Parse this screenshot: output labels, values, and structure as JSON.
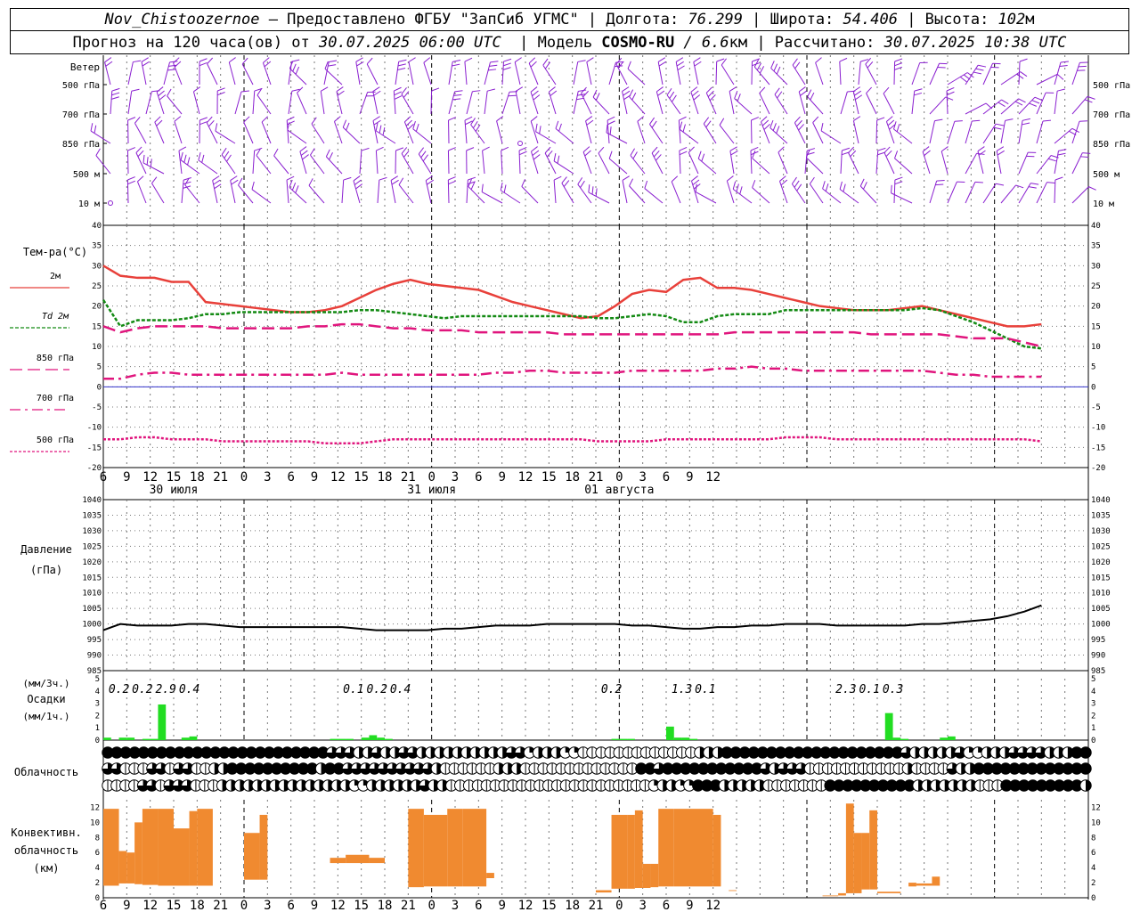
{
  "header": {
    "station": "Nov_Chistoozernoe",
    "provided": " – Предоставлено ФГБУ \"ЗапСиб УГМС\" | Долгота: ",
    "lon": "76.299",
    "lat_label": " | Широта: ",
    "lat": "54.406",
    "alt_label": " | Высота: ",
    "alt": "102",
    "alt_unit": "м",
    "forecast_label": "Прогноз на 120 часа(ов) от ",
    "run_time": "30.07.2025 06:00 UTC",
    "model_label": "  | Модель ",
    "model": "COSMO-RU",
    "model_res": " / 6.6",
    "model_res_unit": "км",
    "calc_label": " | Рассчитано: ",
    "calc_time": "30.07.2025 10:38 UTC"
  },
  "colors": {
    "t2m": "#e8403a",
    "td2m": "#138a13",
    "t850": "#e0157d",
    "t700": "#e0157d",
    "t500": "#e0157d",
    "wind": "#8a1fd0",
    "precip": "#22dd22",
    "conv": "#f08a30",
    "pressure": "#000000",
    "zero": "#3333cc",
    "grid": "#777777"
  },
  "chart_data": [
    {
      "type": "wind-barbs",
      "title": "Ветер",
      "levels": [
        "500 гПа",
        "700 гПа",
        "850 гПа",
        "500 м",
        "10 м"
      ],
      "x_hours": [
        6,
        9,
        12,
        15,
        18,
        21,
        0,
        3,
        6,
        9,
        12,
        15,
        18,
        21,
        0,
        3,
        6,
        9,
        12,
        15,
        18,
        21,
        0,
        3,
        6,
        9,
        12
      ]
    },
    {
      "type": "line",
      "ylabel": "Тем-ра(°C)",
      "ylim": [
        -20,
        40
      ],
      "yticks": [
        -20,
        -15,
        -10,
        -5,
        0,
        5,
        10,
        15,
        20,
        25,
        30,
        35,
        40
      ],
      "x_ticks": [
        "6",
        "9",
        "12",
        "15",
        "18",
        "21",
        "0",
        "3",
        "6",
        "9",
        "12",
        "15",
        "18",
        "21",
        "0",
        "3",
        "6",
        "9",
        "12",
        "15",
        "18",
        "21",
        "0",
        "3",
        "6",
        "9",
        "12"
      ],
      "day_labels": [
        "30 июля",
        "31 июля",
        "01 августа"
      ],
      "series": [
        {
          "name": "2м",
          "values": [
            30,
            27.5,
            27,
            27,
            26,
            26,
            21,
            20.5,
            20,
            19.5,
            19,
            18.5,
            18.5,
            19,
            20,
            22,
            24,
            25.5,
            26.5,
            25.5,
            25,
            24.5,
            24,
            22.5,
            21,
            20,
            19,
            18,
            17,
            17.5,
            20,
            23,
            24,
            23.5,
            26.5,
            27,
            24.5,
            24.5,
            24,
            23,
            22,
            21,
            20,
            19.5,
            19,
            19,
            19,
            19.5,
            20,
            19,
            18,
            17,
            16,
            15,
            15,
            15.5
          ]
        },
        {
          "name": "Td 2м",
          "values": [
            21.5,
            15,
            16.5,
            16.5,
            16.5,
            17,
            18,
            18,
            18.5,
            18.5,
            18.5,
            18.5,
            18.5,
            18.5,
            18.5,
            19,
            19,
            18.5,
            18,
            17.5,
            17,
            17.5,
            17.5,
            17.5,
            17.5,
            17.5,
            17.5,
            17.5,
            17.5,
            17,
            17,
            17.5,
            18,
            17.5,
            16,
            16,
            17.5,
            18,
            18,
            18,
            19,
            19,
            19,
            19,
            19,
            19,
            19,
            19,
            19.5,
            19,
            17.5,
            16,
            14,
            12,
            10,
            9.5
          ]
        },
        {
          "name": "850 гПа",
          "values": [
            15,
            13.5,
            14.5,
            15,
            15,
            15,
            15,
            14.5,
            14.5,
            14.5,
            14.5,
            14.5,
            15,
            15,
            15.5,
            15.5,
            15,
            14.5,
            14.5,
            14,
            14,
            14,
            13.5,
            13.5,
            13.5,
            13.5,
            13.5,
            13,
            13,
            13,
            13,
            13,
            13,
            13,
            13,
            13,
            13,
            13.5,
            13.5,
            13.5,
            13.5,
            13.5,
            13.5,
            13.5,
            13.5,
            13,
            13,
            13,
            13,
            13,
            12.5,
            12,
            12,
            12,
            11,
            10
          ]
        },
        {
          "name": "700 гПа",
          "values": [
            2,
            2,
            3,
            3.5,
            3.5,
            3,
            3,
            3,
            3,
            3,
            3,
            3,
            3,
            3,
            3.5,
            3,
            3,
            3,
            3,
            3,
            3,
            3,
            3,
            3.5,
            3.5,
            4,
            4,
            3.5,
            3.5,
            3.5,
            3.5,
            4,
            4,
            4,
            4,
            4,
            4.5,
            4.5,
            5,
            4.5,
            4.5,
            4,
            4,
            4,
            4,
            4,
            4,
            4,
            4,
            3.5,
            3,
            3,
            2.5,
            2.5,
            2.5,
            2.5
          ]
        },
        {
          "name": "500 гПа",
          "values": [
            -13,
            -13,
            -12.5,
            -12.5,
            -13,
            -13,
            -13,
            -13.5,
            -13.5,
            -13.5,
            -13.5,
            -13.5,
            -13.5,
            -14,
            -14,
            -14,
            -13.5,
            -13,
            -13,
            -13,
            -13,
            -13,
            -13,
            -13,
            -13,
            -13,
            -13,
            -13,
            -13,
            -13.5,
            -13.5,
            -13.5,
            -13.5,
            -13,
            -13,
            -13,
            -13,
            -13,
            -13,
            -13,
            -12.5,
            -12.5,
            -12.5,
            -13,
            -13,
            -13,
            -13,
            -13,
            -13,
            -13,
            -13,
            -13,
            -13,
            -13,
            -13,
            -13.5
          ]
        }
      ]
    },
    {
      "type": "line",
      "ylabel": "Давление",
      "ylabel2": "(гПа)",
      "ylim": [
        985,
        1040
      ],
      "yticks": [
        985,
        990,
        995,
        1000,
        1005,
        1010,
        1015,
        1020,
        1025,
        1030,
        1035,
        1040
      ],
      "series": [
        {
          "name": "pressure",
          "values": [
            998,
            1000,
            999.5,
            999.5,
            999.5,
            1000,
            1000,
            999.5,
            999,
            999,
            999,
            999,
            999,
            999,
            999,
            998.5,
            998,
            998,
            998,
            998,
            998.5,
            998.5,
            999,
            999.5,
            999.5,
            999.5,
            1000,
            1000,
            1000,
            1000,
            1000,
            999.5,
            999.5,
            999,
            998.5,
            998.5,
            999,
            999,
            999.5,
            999.5,
            1000,
            1000,
            1000,
            999.5,
            999.5,
            999.5,
            999.5,
            999.5,
            1000,
            1000,
            1000.5,
            1001,
            1001.5,
            1002.5,
            1004,
            1006
          ]
        }
      ]
    },
    {
      "type": "bar",
      "ylabel_top": "(мм/3ч.)",
      "ylabel": "Осадки",
      "ylabel2": "(мм/1ч.)",
      "ylim": [
        0,
        5
      ],
      "yticks": [
        0,
        1,
        2,
        3,
        4,
        5
      ],
      "hourly_values": [
        0.2,
        0,
        0.2,
        0.2,
        0,
        0.1,
        0.1,
        2.9,
        0,
        0,
        0.2,
        0.3,
        0,
        0,
        0,
        0,
        0,
        0,
        0,
        0,
        0,
        0,
        0,
        0,
        0,
        0,
        0,
        0,
        0,
        0.1,
        0.1,
        0.1,
        0,
        0.2,
        0.4,
        0.2,
        0.1,
        0,
        0,
        0,
        0,
        0,
        0,
        0,
        0,
        0,
        0,
        0,
        0,
        0,
        0,
        0,
        0,
        0,
        0,
        0,
        0,
        0,
        0,
        0,
        0,
        0,
        0,
        0,
        0,
        0.1,
        0.1,
        0.1,
        0,
        0,
        0,
        0,
        1.1,
        0.2,
        0.2,
        0.1,
        0,
        0,
        0,
        0,
        0,
        0,
        0,
        0,
        0,
        0,
        0,
        0,
        0,
        0,
        0,
        0,
        0,
        0,
        0,
        0,
        0,
        0,
        0,
        0,
        2.2,
        0.2,
        0.1,
        0,
        0,
        0,
        0,
        0.2,
        0.3,
        0,
        0,
        0,
        0,
        0,
        0,
        0
      ],
      "three_hour_labels": [
        {
          "hour_index": 0,
          "value": "0.2"
        },
        {
          "hour_index": 3,
          "value": "0.2"
        },
        {
          "hour_index": 6,
          "value": "2.9"
        },
        {
          "hour_index": 9,
          "value": "0.4"
        },
        {
          "hour_index": 30,
          "value": "0.1"
        },
        {
          "hour_index": 33,
          "value": "0.2"
        },
        {
          "hour_index": 36,
          "value": "0.4"
        },
        {
          "hour_index": 63,
          "value": "0.2"
        },
        {
          "hour_index": 72,
          "value": "1.3"
        },
        {
          "hour_index": 75,
          "value": "0.1"
        },
        {
          "hour_index": 93,
          "value": "2.3"
        },
        {
          "hour_index": 96,
          "value": "0.1"
        },
        {
          "hour_index": 99,
          "value": "0.3"
        }
      ]
    },
    {
      "type": "cloud-symbols",
      "ylabel": "Облачность",
      "rows": [
        "FFFFFFFFFFFFFFFFFFFFFFFFFTTTHHTHHTTHHHHHHHHHHTTQHHHQQEEEEEEEEEEEEEHHHFFFFFFFFFFFFFFFFFFFFTHHHHHTQQHHHTTTTHHHFF",
        "TTEEETTETTEEHHFFFFFFFFFFHFFTTTTTTTTTTHEEEEEEHHHEEEEEEEEEEEEEFFTFFFFFFFFFFFTHTTTEEEEEEEEEEEHEEEETHHFFFFFFFFFFFFF",
        "EEEETTETTTEEEHHHHHHHHHHHHHHHQQHHHHHHTHHEEEEEEEEEEEEEEEEEEEEEEEQHHQQFFFHHHHHEEEEEEEFFFFFFFFFFHHHHHHHEEEFFFFFFFFFH"
      ]
    },
    {
      "type": "bar",
      "ylabel": "Конвективн.",
      "ylabel2": "облачность",
      "ylabel3": "(км)",
      "ylim": [
        0,
        13
      ],
      "yticks": [
        0,
        2,
        4,
        6,
        8,
        10,
        12
      ],
      "bars": [
        {
          "h0": 0,
          "h1": 2,
          "base": 1.6,
          "top": 11.8
        },
        {
          "h0": 2,
          "h1": 3,
          "base": 1.9,
          "top": 6.2
        },
        {
          "h0": 3,
          "h1": 4,
          "base": 1.9,
          "top": 6.0
        },
        {
          "h0": 4,
          "h1": 5,
          "base": 1.8,
          "top": 10.0
        },
        {
          "h0": 5,
          "h1": 7,
          "base": 1.7,
          "top": 11.8
        },
        {
          "h0": 7,
          "h1": 9,
          "base": 1.6,
          "top": 11.8
        },
        {
          "h0": 9,
          "h1": 11,
          "base": 1.6,
          "top": 9.2
        },
        {
          "h0": 11,
          "h1": 12,
          "base": 1.6,
          "top": 11.5
        },
        {
          "h0": 12,
          "h1": 14,
          "base": 1.6,
          "top": 11.8
        },
        {
          "h0": 18,
          "h1": 20,
          "base": 2.4,
          "top": 8.6
        },
        {
          "h0": 20,
          "h1": 21,
          "base": 2.4,
          "top": 11.0
        },
        {
          "h0": 29,
          "h1": 31,
          "base": 4.6,
          "top": 5.3
        },
        {
          "h0": 31,
          "h1": 34,
          "base": 4.6,
          "top": 5.7
        },
        {
          "h0": 34,
          "h1": 36,
          "base": 4.6,
          "top": 5.3
        },
        {
          "h0": 39,
          "h1": 41,
          "base": 1.4,
          "top": 11.8
        },
        {
          "h0": 41,
          "h1": 44,
          "base": 1.5,
          "top": 11.0
        },
        {
          "h0": 44,
          "h1": 46,
          "base": 1.5,
          "top": 11.8
        },
        {
          "h0": 46,
          "h1": 49,
          "base": 1.5,
          "top": 11.8
        },
        {
          "h0": 49,
          "h1": 50,
          "base": 2.6,
          "top": 3.3
        },
        {
          "h0": 63,
          "h1": 65,
          "base": 0.7,
          "top": 1.0
        },
        {
          "h0": 65,
          "h1": 67,
          "base": 1.2,
          "top": 11.0
        },
        {
          "h0": 67,
          "h1": 68,
          "base": 1.2,
          "top": 11.0
        },
        {
          "h0": 68,
          "h1": 69,
          "base": 1.3,
          "top": 11.6
        },
        {
          "h0": 69,
          "h1": 70,
          "base": 1.3,
          "top": 4.5
        },
        {
          "h0": 70,
          "h1": 71,
          "base": 1.4,
          "top": 4.5
        },
        {
          "h0": 71,
          "h1": 73,
          "base": 1.5,
          "top": 11.8
        },
        {
          "h0": 73,
          "h1": 78,
          "base": 1.5,
          "top": 11.8
        },
        {
          "h0": 78,
          "h1": 79,
          "base": 1.5,
          "top": 11.0
        },
        {
          "h0": 80,
          "h1": 81,
          "base": 0.9,
          "top": 1.0
        },
        {
          "h0": 92,
          "h1": 94,
          "base": 0.2,
          "top": 0.3
        },
        {
          "h0": 94,
          "h1": 95,
          "base": 0.3,
          "top": 0.6
        },
        {
          "h0": 95,
          "h1": 96,
          "base": 0.6,
          "top": 12.5
        },
        {
          "h0": 96,
          "h1": 97,
          "base": 0.6,
          "top": 8.6
        },
        {
          "h0": 97,
          "h1": 98,
          "base": 1.1,
          "top": 8.6
        },
        {
          "h0": 98,
          "h1": 99,
          "base": 1.1,
          "top": 11.6
        },
        {
          "h0": 99,
          "h1": 102,
          "base": 0.6,
          "top": 0.8
        },
        {
          "h0": 103,
          "h1": 104,
          "base": 1.5,
          "top": 2.0
        },
        {
          "h0": 104,
          "h1": 106,
          "base": 1.6,
          "top": 1.9
        },
        {
          "h0": 106,
          "h1": 107,
          "base": 1.6,
          "top": 2.8
        }
      ]
    }
  ]
}
